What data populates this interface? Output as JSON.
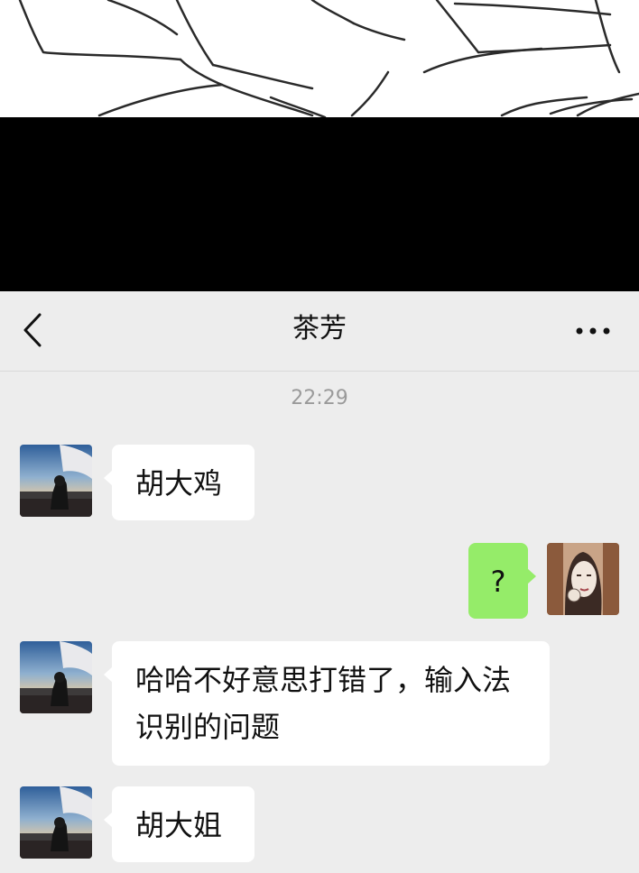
{
  "chat": {
    "title": "茶芳",
    "timestamp": "22:29",
    "messages": [
      {
        "sender": "contact",
        "text": "胡大鸡"
      },
      {
        "sender": "self",
        "text": "?"
      },
      {
        "sender": "contact",
        "text": "哈哈不好意思打错了，输入法识别的问题"
      },
      {
        "sender": "contact",
        "text": "胡大姐"
      }
    ]
  },
  "colors": {
    "chat_background": "#ededed",
    "incoming_bubble": "#ffffff",
    "outgoing_bubble": "#95ec69"
  },
  "icons": {
    "back": "chevron-left-icon",
    "more": "ellipsis-icon"
  }
}
